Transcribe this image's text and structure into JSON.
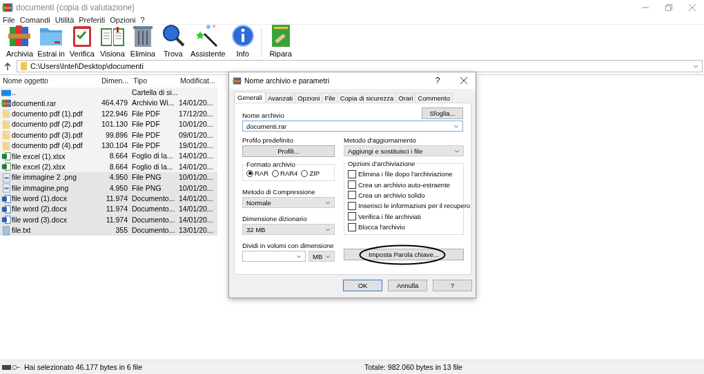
{
  "window": {
    "title": "documenti (copia di valutazione)"
  },
  "menu": [
    "File",
    "Comandi",
    "Utilità",
    "Preferiti",
    "Opzioni",
    "?"
  ],
  "toolbar": [
    {
      "label": "Archivia",
      "kind": "archive"
    },
    {
      "label": "Estrai in",
      "kind": "extract"
    },
    {
      "label": "Verifica",
      "kind": "verify"
    },
    {
      "label": "Visiona",
      "kind": "view"
    },
    {
      "label": "Elimina",
      "kind": "delete"
    },
    {
      "label": "Trova",
      "kind": "find"
    },
    {
      "label": "Assistente",
      "kind": "wizard"
    },
    {
      "label": "Info",
      "kind": "info"
    },
    {
      "label": "Ripara",
      "kind": "repair"
    }
  ],
  "address": {
    "path": "C:\\Users\\Intel\\Desktop\\documenti"
  },
  "file_list": {
    "columns": [
      "Nome oggetto",
      "Dimen...",
      "Tipo",
      "Modificat..."
    ],
    "rows": [
      {
        "name": "..",
        "kind": "up",
        "type": "Cartella di si...",
        "selected": false
      },
      {
        "name": "documenti.rar",
        "kind": "rar",
        "size": "464.479",
        "type": "Archivio Wi...",
        "modified": "14/01/20...",
        "selected": false
      },
      {
        "name": "documento pdf (1).pdf",
        "kind": "pdf",
        "size": "122.946",
        "type": "File PDF",
        "modified": "17/12/20...",
        "selected": false
      },
      {
        "name": "documento pdf (2).pdf",
        "kind": "pdf",
        "size": "101.130",
        "type": "File PDF",
        "modified": "10/01/20...",
        "selected": false
      },
      {
        "name": "documento pdf (3).pdf",
        "kind": "pdf",
        "size": "99.896",
        "type": "File PDF",
        "modified": "09/01/20...",
        "selected": false
      },
      {
        "name": "documento pdf (4).pdf",
        "kind": "pdf",
        "size": "130.104",
        "type": "File PDF",
        "modified": "19/01/20...",
        "selected": false
      },
      {
        "name": "file excel (1).xlsx",
        "kind": "excel",
        "size": "8.664",
        "type": "Foglio di la...",
        "modified": "14/01/20...",
        "selected": false
      },
      {
        "name": "file excel (2).xlsx",
        "kind": "excel",
        "size": "8.664",
        "type": "Foglio di la...",
        "modified": "14/01/20...",
        "selected": false
      },
      {
        "name": "file immagine 2 .png",
        "kind": "image",
        "size": "4.950",
        "type": "File PNG",
        "modified": "10/01/20...",
        "selected": true
      },
      {
        "name": "file immagine.png",
        "kind": "image",
        "size": "4.950",
        "type": "File PNG",
        "modified": "10/01/20...",
        "selected": true
      },
      {
        "name": "file word (1).docx",
        "kind": "word",
        "size": "11.974",
        "type": "Documento...",
        "modified": "14/01/20...",
        "selected": true
      },
      {
        "name": "file word (2).docx",
        "kind": "word",
        "size": "11.974",
        "type": "Documento...",
        "modified": "14/01/20...",
        "selected": true
      },
      {
        "name": "file word (3).docx",
        "kind": "word",
        "size": "11.974",
        "type": "Documento...",
        "modified": "14/01/20...",
        "selected": true
      },
      {
        "name": "file.txt",
        "kind": "text",
        "size": "355",
        "type": "Documento...",
        "modified": "13/01/20...",
        "selected": true
      }
    ]
  },
  "dialog": {
    "title": "Nome archivio e parametri",
    "help": "?",
    "tabs": [
      {
        "label": "Generali",
        "selected": true
      },
      {
        "label": "Avanzati",
        "selected": false
      },
      {
        "label": "Opzioni",
        "selected": false
      },
      {
        "label": "File",
        "selected": false
      },
      {
        "label": "Copia di sicurezza",
        "selected": false
      },
      {
        "label": "Orari",
        "selected": false
      },
      {
        "label": "Commento",
        "selected": false
      }
    ],
    "archive_name": {
      "label": "Nome archivio",
      "value": "documenti.rar",
      "browse": "Sfoglia..."
    },
    "profile": {
      "label": "Profilo predefinito",
      "button": "Profili..."
    },
    "update_method": {
      "label": "Metodo d'aggiornamento",
      "value": "Aggiungi e sostituisci i file"
    },
    "format": {
      "label": "Formato archivio",
      "options": [
        {
          "label": "RAR",
          "selected": true
        },
        {
          "label": "RAR4",
          "selected": false
        },
        {
          "label": "ZIP",
          "selected": false
        }
      ]
    },
    "archive_options": {
      "label": "Opzioni d'archiviazione",
      "options": [
        {
          "label": "Elimina i file dopo l'archiviazione",
          "checked": false
        },
        {
          "label": "Crea un archivio auto-estraente",
          "checked": false
        },
        {
          "label": "Crea un archivio solido",
          "checked": false
        },
        {
          "label": "Inserisci le informazioni per il recupero",
          "checked": false
        },
        {
          "label": "Verifica i file archiviati",
          "checked": false
        },
        {
          "label": "Blocca l'archivio",
          "checked": false
        }
      ]
    },
    "compression": {
      "label": "Metodo di Compressione",
      "value": "Normale"
    },
    "dictionary": {
      "label": "Dimensione dizionario",
      "value": "32 MB"
    },
    "split": {
      "label": "Dividi in volumi con dimensione",
      "unit": "MB"
    },
    "password_button": "Imposta Parola chiave...",
    "buttons": [
      "OK",
      "Annulla",
      "?"
    ]
  },
  "status_bar": {
    "left": "Hai selezionato 46.177 bytes in 6 file",
    "right": "Totale: 982.060 bytes in 13 file"
  }
}
